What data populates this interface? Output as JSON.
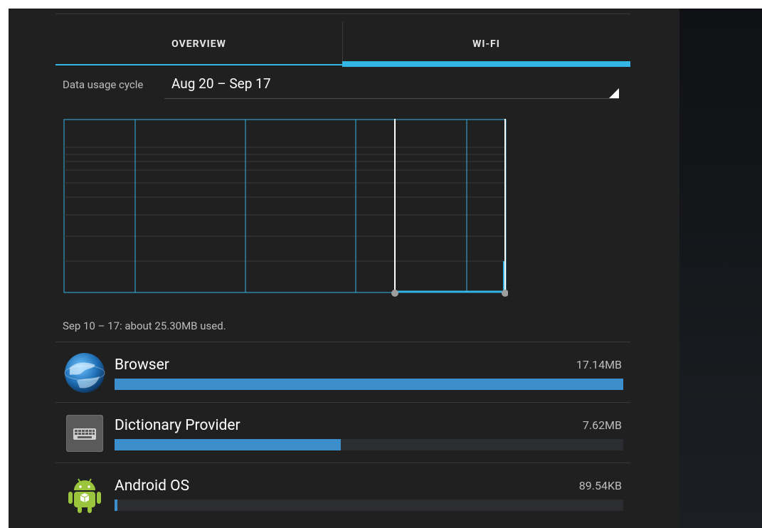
{
  "tabs": [
    {
      "label": "OVERVIEW",
      "selected": false
    },
    {
      "label": "WI-FI",
      "selected": true
    }
  ],
  "cycle": {
    "label": "Data usage cycle",
    "value": "Aug 20 – Sep 17"
  },
  "summary": "Sep 10 – 17: about 25.30MB used.",
  "apps": [
    {
      "name": "Browser",
      "size": "17.14MB",
      "icon": "globe-icon",
      "usage_fraction": 1.0
    },
    {
      "name": "Dictionary Provider",
      "size": "7.62MB",
      "icon": "keyboard-icon",
      "usage_fraction": 0.445
    },
    {
      "name": "Android OS",
      "size": "89.54KB",
      "icon": "android-icon",
      "usage_fraction": 0.005
    }
  ],
  "colors": {
    "accent": "#33b5e5",
    "bar": "#3c8fcb",
    "background": "#202020"
  }
}
